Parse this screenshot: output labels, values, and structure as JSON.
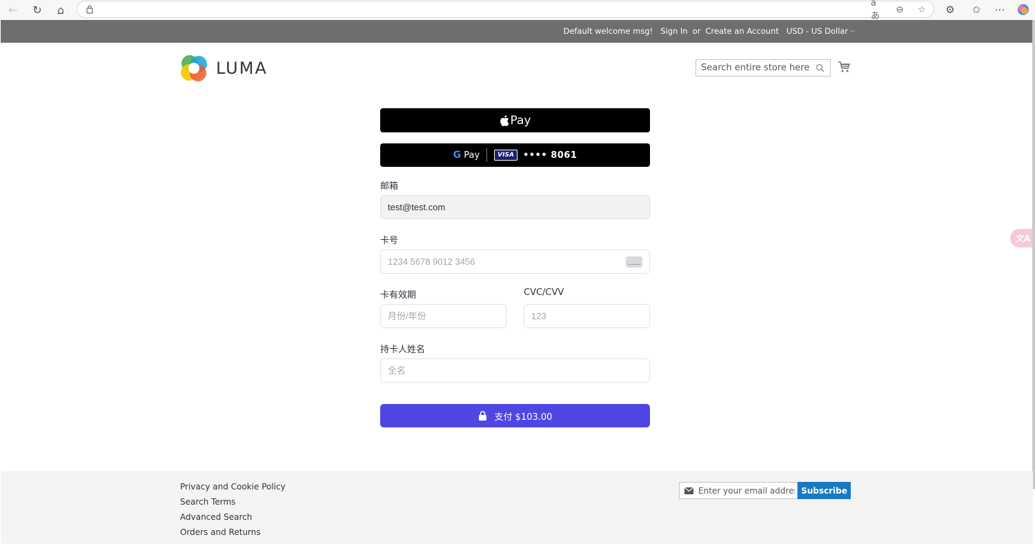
{
  "browser": {
    "back_icon": "arrow-left-icon",
    "reload_icon": "reload-icon",
    "home_icon": "home-icon",
    "address_url": ""
  },
  "panel": {
    "welcome": "Default welcome msg!",
    "sign_in": "Sign In",
    "or": "or",
    "create_account": "Create an Account",
    "currency": "USD - US Dollar"
  },
  "header": {
    "logo_text": "LUMA",
    "search_placeholder": "Search entire store here..."
  },
  "payment": {
    "apple_pay_label": "Pay",
    "google_pay_label": "Pay",
    "google_pay_g": "G",
    "visa_label": "VISA",
    "card_last_digits": "•••• 8061",
    "email_label": "邮箱",
    "email_value": "test@test.com",
    "card_number_label": "卡号",
    "card_number_placeholder": "1234 5678 9012 3456",
    "expiry_label": "卡有效期",
    "expiry_placeholder": "月份/年份",
    "cvc_label": "CVC/CVV",
    "cvc_placeholder": "123",
    "cardholder_label": "持卡人姓名",
    "cardholder_placeholder": "全名",
    "pay_button": "支付 $103.00",
    "accent_color": "#5046e4"
  },
  "translate_badge": "文A",
  "footer": {
    "links": [
      "Privacy and Cookie Policy",
      "Search Terms",
      "Advanced Search",
      "Orders and Returns"
    ],
    "newsletter_placeholder": "Enter your email address",
    "subscribe": "Subscribe"
  }
}
